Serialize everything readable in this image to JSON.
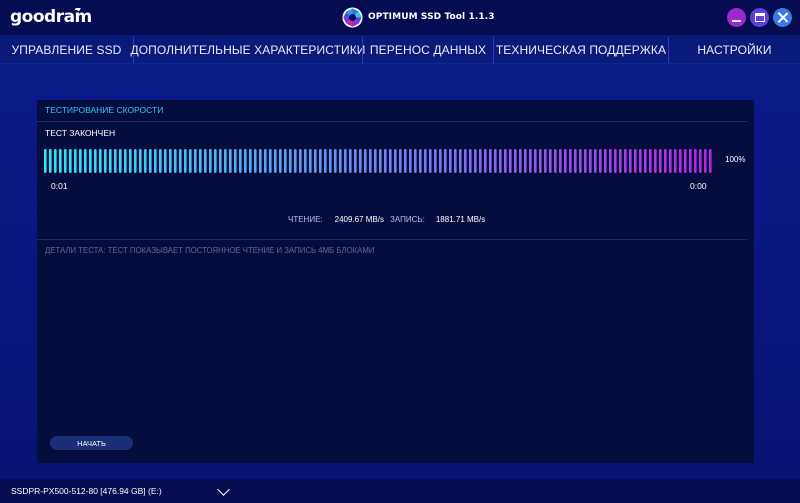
{
  "app": {
    "logo": "goodram",
    "title": "OPTIMUM SSD Tool 1.1.3",
    "emblem_icon": "aperture-emblem-icon",
    "window_controls": {
      "minimize_icon": "minimize-icon",
      "maximize_icon": "maximize-icon",
      "close_icon": "close-icon"
    }
  },
  "menu": {
    "items": [
      {
        "label": "УПРАВЛЕНИЕ SSD"
      },
      {
        "label": "ДОПОЛНИТЕЛЬНЫЕ ХАРАКТЕРИСТИКИ"
      },
      {
        "label": "ПЕРЕНОС ДАННЫХ"
      },
      {
        "label": "ТЕХНИЧЕСКАЯ ПОДДЕРЖКА"
      },
      {
        "label": "НАСТРОЙКИ"
      }
    ]
  },
  "speed_test": {
    "title": "ТЕСТИРОВАНИЕ СКОРОСТИ",
    "status": "ТЕСТ ЗАКОНЧЕН",
    "progress_percent": 100,
    "progress_label": "100%",
    "elapsed": "0:01",
    "remaining": "0:00",
    "read_label": "ЧТЕНИЕ:",
    "read_value": "2409.67 MB/s",
    "write_label": "ЗАПИСЬ:",
    "write_value": "1881.71 MB/s",
    "details": "ДЕТАЛИ ТЕСТА: ТЕСТ ПОКАЗЫВАЕТ ПОСТОЯННОЕ ЧТЕНИЕ И ЗАПИСЬ 4МБ БЛОКАМИ",
    "start_label": "НАЧАТЬ",
    "colors": {
      "bar_start": "#2ee6f5",
      "bar_end": "#b428e0",
      "accent": "#33c8f0"
    }
  },
  "drive": {
    "selected": "SSDPR-PX500-512-80 [476.94 GB] (E:)",
    "dropdown_icon": "chevron-down-icon"
  }
}
